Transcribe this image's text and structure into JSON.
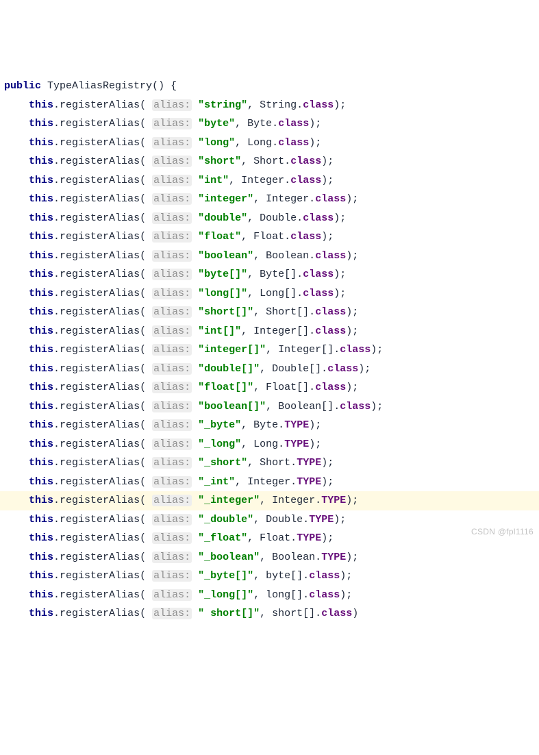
{
  "signature": {
    "modifier": "public",
    "name": "TypeAliasRegistry",
    "parens": "()",
    "brace": " {"
  },
  "hint_label": "alias:",
  "this_kw": "this",
  "method": "registerAlias",
  "field_class": "class",
  "field_type": "TYPE",
  "lines": [
    {
      "str": "\"string\"",
      "cls": "String",
      "field": "class",
      "hl": false
    },
    {
      "str": "\"byte\"",
      "cls": "Byte",
      "field": "class",
      "hl": false
    },
    {
      "str": "\"long\"",
      "cls": "Long",
      "field": "class",
      "hl": false
    },
    {
      "str": "\"short\"",
      "cls": "Short",
      "field": "class",
      "hl": false
    },
    {
      "str": "\"int\"",
      "cls": "Integer",
      "field": "class",
      "hl": false
    },
    {
      "str": "\"integer\"",
      "cls": "Integer",
      "field": "class",
      "hl": false
    },
    {
      "str": "\"double\"",
      "cls": "Double",
      "field": "class",
      "hl": false
    },
    {
      "str": "\"float\"",
      "cls": "Float",
      "field": "class",
      "hl": false
    },
    {
      "str": "\"boolean\"",
      "cls": "Boolean",
      "field": "class",
      "hl": false
    },
    {
      "str": "\"byte[]\"",
      "cls": "Byte[]",
      "field": "class",
      "hl": false
    },
    {
      "str": "\"long[]\"",
      "cls": "Long[]",
      "field": "class",
      "hl": false
    },
    {
      "str": "\"short[]\"",
      "cls": "Short[]",
      "field": "class",
      "hl": false
    },
    {
      "str": "\"int[]\"",
      "cls": "Integer[]",
      "field": "class",
      "hl": false
    },
    {
      "str": "\"integer[]\"",
      "cls": "Integer[]",
      "field": "class",
      "hl": false
    },
    {
      "str": "\"double[]\"",
      "cls": "Double[]",
      "field": "class",
      "hl": false
    },
    {
      "str": "\"float[]\"",
      "cls": "Float[]",
      "field": "class",
      "hl": false
    },
    {
      "str": "\"boolean[]\"",
      "cls": "Boolean[]",
      "field": "class",
      "hl": false
    },
    {
      "str": "\"_byte\"",
      "cls": "Byte",
      "field": "TYPE",
      "hl": false
    },
    {
      "str": "\"_long\"",
      "cls": "Long",
      "field": "TYPE",
      "hl": false
    },
    {
      "str": "\"_short\"",
      "cls": "Short",
      "field": "TYPE",
      "hl": false
    },
    {
      "str": "\"_int\"",
      "cls": "Integer",
      "field": "TYPE",
      "hl": false
    },
    {
      "str": "\"_integer\"",
      "cls": "Integer",
      "field": "TYPE",
      "hl": true
    },
    {
      "str": "\"_double\"",
      "cls": "Double",
      "field": "TYPE",
      "hl": false
    },
    {
      "str": "\"_float\"",
      "cls": "Float",
      "field": "TYPE",
      "hl": false
    },
    {
      "str": "\"_boolean\"",
      "cls": "Boolean",
      "field": "TYPE",
      "hl": false
    },
    {
      "str": "\"_byte[]\"",
      "cls": "byte[]",
      "field": "class",
      "hl": false
    },
    {
      "str": "\"_long[]\"",
      "cls": "long[]",
      "field": "class",
      "hl": false
    },
    {
      "str": "\" short[]\"",
      "cls": "short[]",
      "field": "class",
      "hl": false,
      "truncated": true
    }
  ],
  "watermark": "CSDN @fpl1116"
}
